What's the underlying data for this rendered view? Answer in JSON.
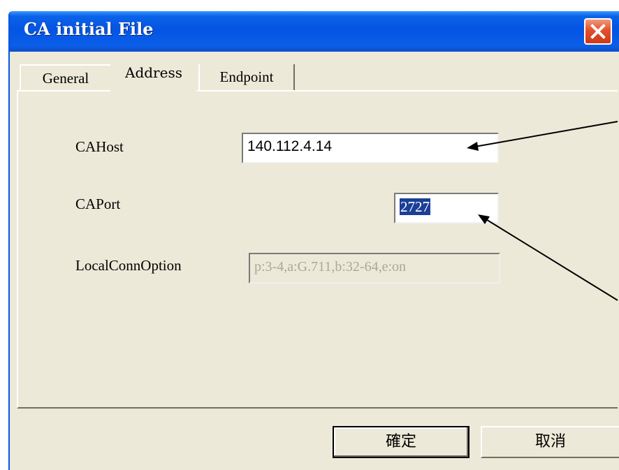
{
  "window": {
    "title": "CA initial File"
  },
  "tabs": [
    {
      "label": "General",
      "active": false
    },
    {
      "label": "Address",
      "active": true
    },
    {
      "label": "Endpoint",
      "active": false
    }
  ],
  "form": {
    "ca_host": {
      "label": "CAHost",
      "value": "140.112.4.14"
    },
    "ca_port": {
      "label": "CAPort",
      "value": "2727",
      "selected": true
    },
    "local_conn_option": {
      "label": "LocalConnOption",
      "value": "p:3-4,a:G.711,b:32-64,e:on",
      "disabled": true
    }
  },
  "buttons": {
    "ok_label": "確定",
    "cancel_label": "取消"
  },
  "icons": {
    "close": "close-icon"
  },
  "colors": {
    "titlebar": "#0554e3",
    "dialog_bg": "#ece9d8",
    "close_button": "#e2502c",
    "selection": "#1c3f96"
  }
}
